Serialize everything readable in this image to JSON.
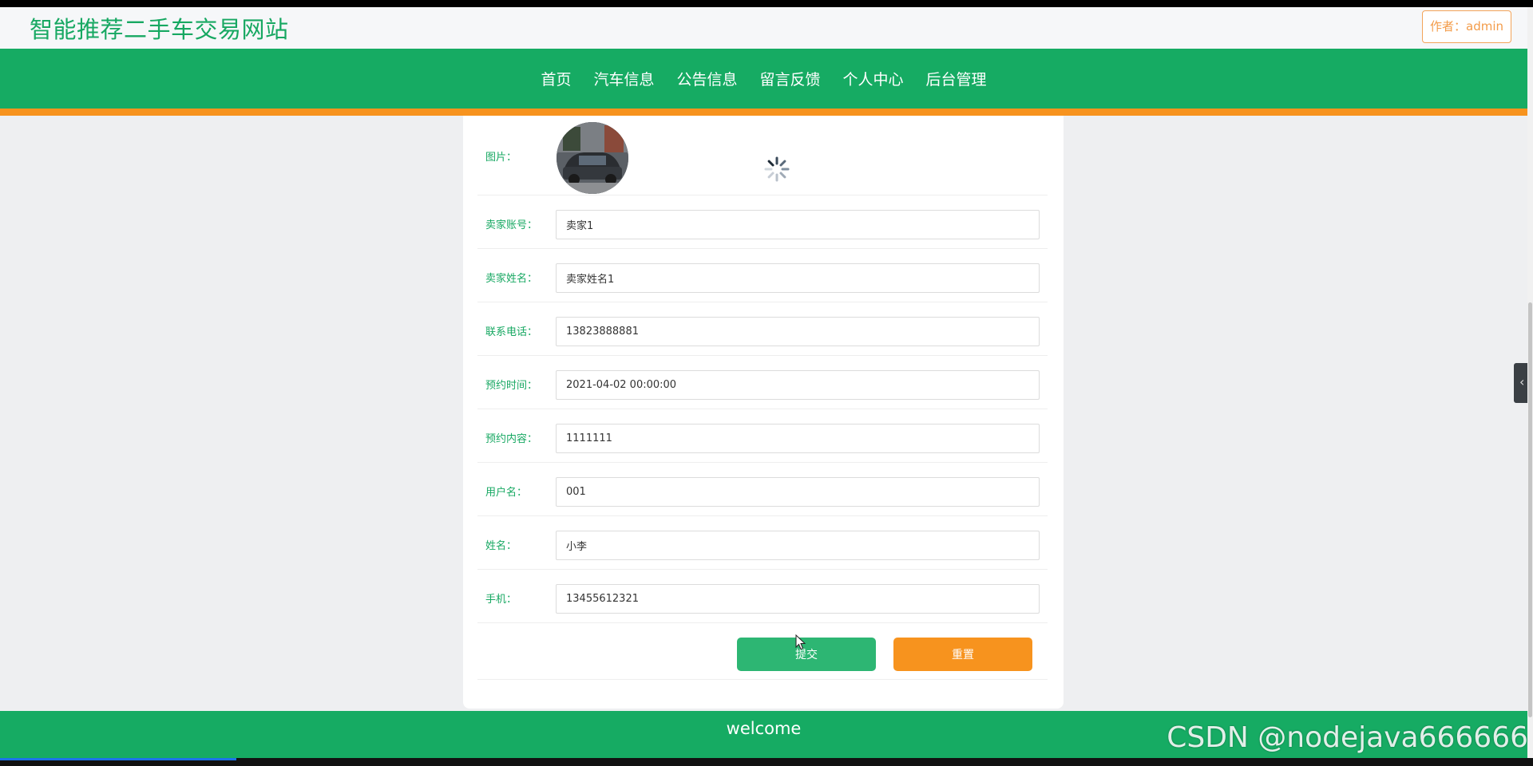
{
  "header": {
    "site_title": "智能推荐二手车交易网站",
    "author_label": "作者：admin"
  },
  "nav": {
    "items": [
      {
        "label": "首页"
      },
      {
        "label": "汽车信息"
      },
      {
        "label": "公告信息"
      },
      {
        "label": "留言反馈"
      },
      {
        "label": "个人中心"
      },
      {
        "label": "后台管理"
      }
    ]
  },
  "form": {
    "image_label": "图片：",
    "fields": [
      {
        "label": "卖家账号：",
        "value": "卖家1"
      },
      {
        "label": "卖家姓名：",
        "value": "卖家姓名1"
      },
      {
        "label": "联系电话：",
        "value": "13823888881"
      },
      {
        "label": "预约时间：",
        "value": "2021-04-02 00:00:00"
      },
      {
        "label": "预约内容：",
        "value": "1111111"
      },
      {
        "label": "用户名：",
        "value": "001"
      },
      {
        "label": "姓名：",
        "value": "小李"
      },
      {
        "label": "手机：",
        "value": "13455612321"
      }
    ],
    "submit_label": "提交",
    "reset_label": "重置"
  },
  "footer": {
    "text": "welcome"
  },
  "watermark": "CSDN @nodejava666666",
  "colors": {
    "primary_green": "#16ab63",
    "accent_orange": "#f7931e",
    "page_bg": "#eeeff1"
  },
  "icons": {
    "loading": "loading-spinner-icon",
    "side_toggle": "chevron-left-icon",
    "cursor": "mouse-cursor-icon"
  }
}
